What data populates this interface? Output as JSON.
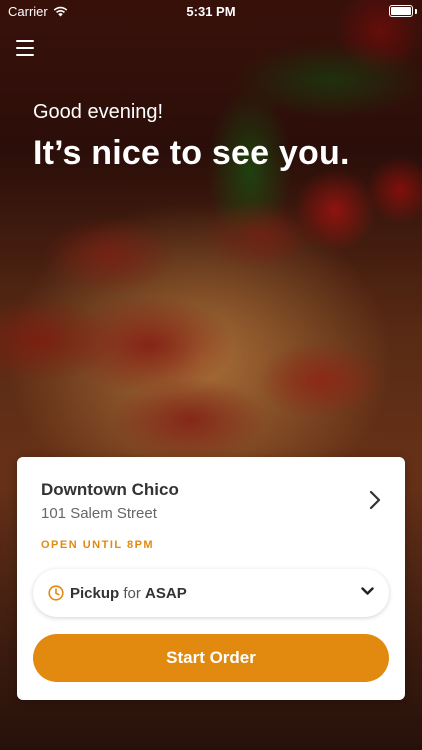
{
  "status_bar": {
    "carrier": "Carrier",
    "time": "5:31 PM"
  },
  "header": {
    "greeting": "Good evening!",
    "headline": "It’s nice to see you."
  },
  "location": {
    "name": "Downtown Chico",
    "address": "101 Salem Street",
    "hours": "OPEN UNTIL 8PM"
  },
  "order_mode": {
    "mode": "Pickup",
    "connector": "for",
    "time": "ASAP"
  },
  "actions": {
    "start_order": "Start Order"
  },
  "icons": {
    "menu": "hamburger-menu-icon",
    "wifi": "wifi-icon",
    "battery": "battery-icon",
    "clock": "clock-icon",
    "chevron_right": "chevron-right-icon",
    "chevron_down": "chevron-down-icon"
  },
  "colors": {
    "accent": "#e28a10",
    "text_dark": "#333333",
    "text_muted": "#666666"
  }
}
